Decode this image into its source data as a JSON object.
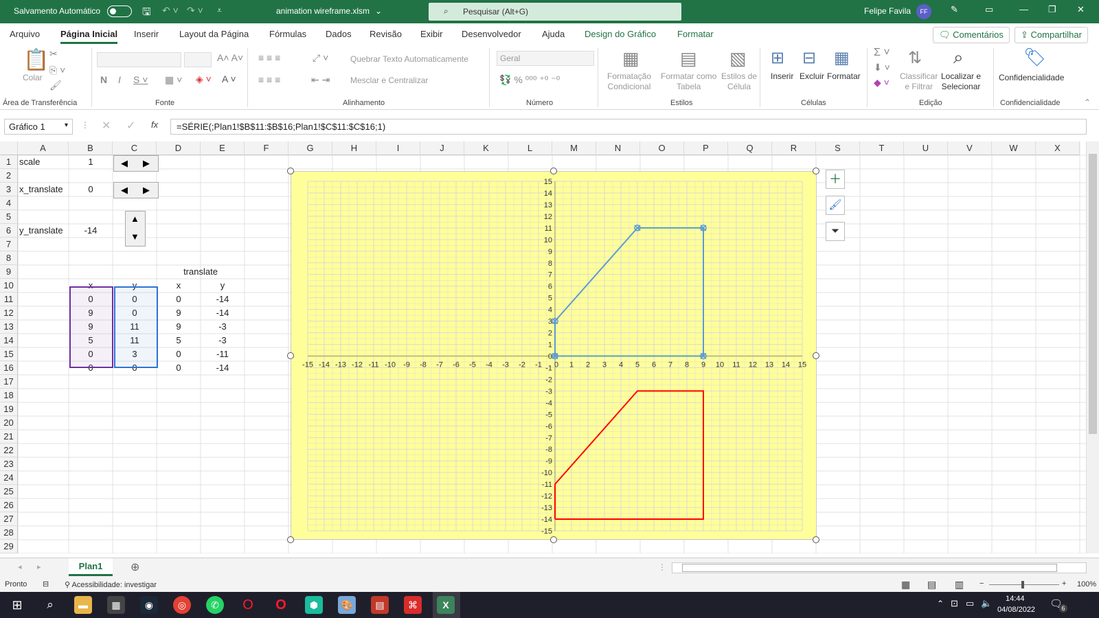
{
  "titlebar": {
    "autosave_label": "Salvamento Automático",
    "filename": "animation wireframe.xlsm",
    "search_placeholder": "Pesquisar (Alt+G)",
    "user_name": "Felipe Favila",
    "user_initials": "FF"
  },
  "tabs": [
    "Arquivo",
    "Página Inicial",
    "Inserir",
    "Layout da Página",
    "Fórmulas",
    "Dados",
    "Revisão",
    "Exibir",
    "Desenvolvedor",
    "Ajuda",
    "Design do Gráfico",
    "Formatar"
  ],
  "comments_label": "Comentários",
  "share_label": "Compartilhar",
  "ribbon": {
    "paste": "Colar",
    "clipboard_group": "Área de Transferência",
    "font_group": "Fonte",
    "wrap_text": "Quebrar Texto Automaticamente",
    "merge_center": "Mesclar e Centralizar",
    "alignment_group": "Alinhamento",
    "number_format": "Geral",
    "number_group": "Número",
    "cond_format": "Formatação\nCondicional",
    "format_table": "Formatar como\nTabela",
    "cell_styles": "Estilos de\nCélula",
    "styles_group": "Estilos",
    "insert": "Inserir",
    "delete": "Excluir",
    "format": "Formatar",
    "cells_group": "Células",
    "sort_filter": "Classificar\ne Filtrar",
    "find_select": "Localizar e\nSelecionar",
    "editing_group": "Edição",
    "sensitivity": "Confidencialidade",
    "sensitivity_group": "Confidencialidade"
  },
  "formula_bar": {
    "name_box": "Gráfico 1",
    "formula": "=SÉRIE(;Plan1!$B$11:$B$16;Plan1!$C$11:$C$16;1)"
  },
  "columns": [
    "A",
    "B",
    "C",
    "D",
    "E",
    "F",
    "G",
    "H",
    "I",
    "J",
    "K",
    "L",
    "M",
    "N",
    "O",
    "P",
    "Q",
    "R",
    "S",
    "T",
    "U",
    "V",
    "W",
    "X"
  ],
  "rows": [
    "1",
    "2",
    "3",
    "4",
    "5",
    "6",
    "7",
    "8",
    "9",
    "10",
    "11",
    "12",
    "13",
    "14",
    "15",
    "16",
    "17",
    "18",
    "19",
    "20",
    "21",
    "22",
    "23",
    "24",
    "25",
    "26",
    "27",
    "28",
    "29"
  ],
  "cells": {
    "a1": "scale",
    "b1": "1",
    "a3": "x_translate",
    "b3": "0",
    "a6": "y_translate",
    "b6": "-14",
    "translate_header": "translate",
    "orig_headers": [
      "x",
      "y"
    ],
    "trans_headers": [
      "x",
      "y"
    ],
    "orig_x": [
      "0",
      "9",
      "9",
      "5",
      "0",
      "0"
    ],
    "orig_y": [
      "0",
      "0",
      "11",
      "11",
      "3",
      "0"
    ],
    "trans_x": [
      "0",
      "9",
      "9",
      "5",
      "0",
      "0"
    ],
    "trans_y": [
      "-14",
      "-14",
      "-3",
      "-3",
      "-11",
      "-14"
    ]
  },
  "chart_data": {
    "type": "scatter",
    "xlim": [
      -15,
      15
    ],
    "ylim": [
      -15,
      15
    ],
    "grid": true,
    "background": "#ffff99",
    "series": [
      {
        "color": "#5b9bd5",
        "markers": true,
        "x": [
          0,
          9,
          9,
          5,
          0,
          0
        ],
        "y": [
          0,
          0,
          11,
          11,
          3,
          0
        ]
      },
      {
        "color": "#ff0000",
        "markers": false,
        "x": [
          0,
          9,
          9,
          5,
          0,
          0
        ],
        "y": [
          -14,
          -14,
          -3,
          -3,
          -11,
          -14
        ]
      }
    ]
  },
  "sheet_tab": "Plan1",
  "status": {
    "ready": "Pronto",
    "accessibility": "Acessibilidade: investigar",
    "zoom": "100%"
  },
  "taskbar": {
    "time": "14:44",
    "date": "04/08/2022",
    "notif_count": "6"
  },
  "colors": {
    "excel_green": "#217346",
    "chart_bg": "#ffff99",
    "series1": "#5b9bd5",
    "series2": "#ff0000"
  }
}
